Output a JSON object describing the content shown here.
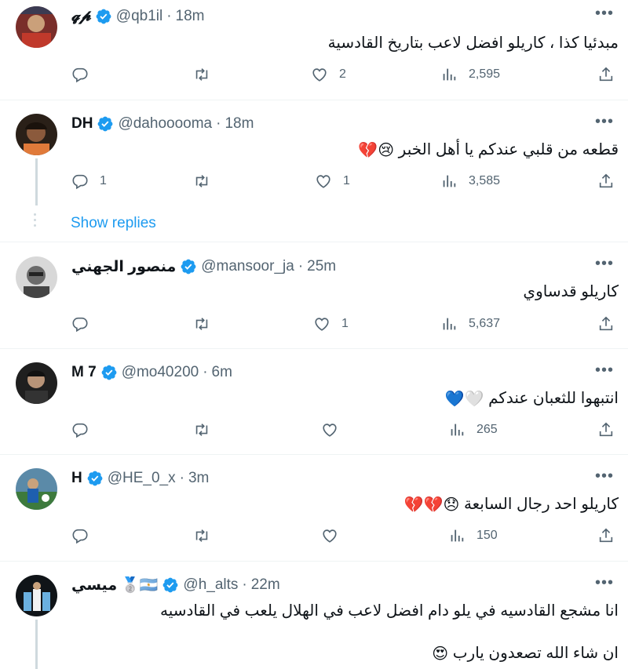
{
  "tweets": [
    {
      "name": "𝓺𝓹",
      "handle": "@qb1il",
      "dot": "·",
      "time": "18m",
      "text": "مبدئيا كذا ، كاريلو افضل لاعب بتاريخ القادسية",
      "replies": "",
      "retweets": "",
      "likes": "2",
      "views": "2,595"
    },
    {
      "name": "DH",
      "handle": "@dahooooma",
      "dot": "·",
      "time": "18m",
      "text": "قطعه من قلبي عندكم يا أهل الخبر",
      "emoji": "😢💔",
      "replies": "1",
      "retweets": "",
      "likes": "1",
      "views": "3,585",
      "show_replies": "Show replies"
    },
    {
      "name": "منصور الجهني",
      "handle": "@mansoor_ja",
      "dot": "·",
      "time": "25m",
      "text": "كاريلو قدساوي",
      "replies": "",
      "retweets": "",
      "likes": "1",
      "views": "5,637"
    },
    {
      "name": "M 7",
      "handle": "@mo40200",
      "dot": "·",
      "time": "6m",
      "text": "انتبهوا للثعبان عندكم",
      "emoji": "🤍💙",
      "replies": "",
      "retweets": "",
      "likes": "",
      "views": "265"
    },
    {
      "name": "H",
      "handle": "@HE_0_x",
      "dot": "·",
      "time": "3m",
      "text": "كاريلو احد رجال السابعة",
      "emoji": "😞💔💔",
      "replies": "",
      "retweets": "",
      "likes": "",
      "views": "150"
    },
    {
      "name": "ميسي",
      "badges": "🥈🇦🇷",
      "handle": "@h_alts",
      "dot": "·",
      "time": "22m",
      "text": "انا مشجع القادسيه في يلو دام افضل لاعب في الهلال يلعب في القادسيه",
      "text2": "ان شاء الله تصعدون يارب",
      "emoji2": "😍"
    }
  ],
  "colors": {
    "accent": "#1d9bf0",
    "muted": "#536471",
    "text": "#0f1419"
  }
}
